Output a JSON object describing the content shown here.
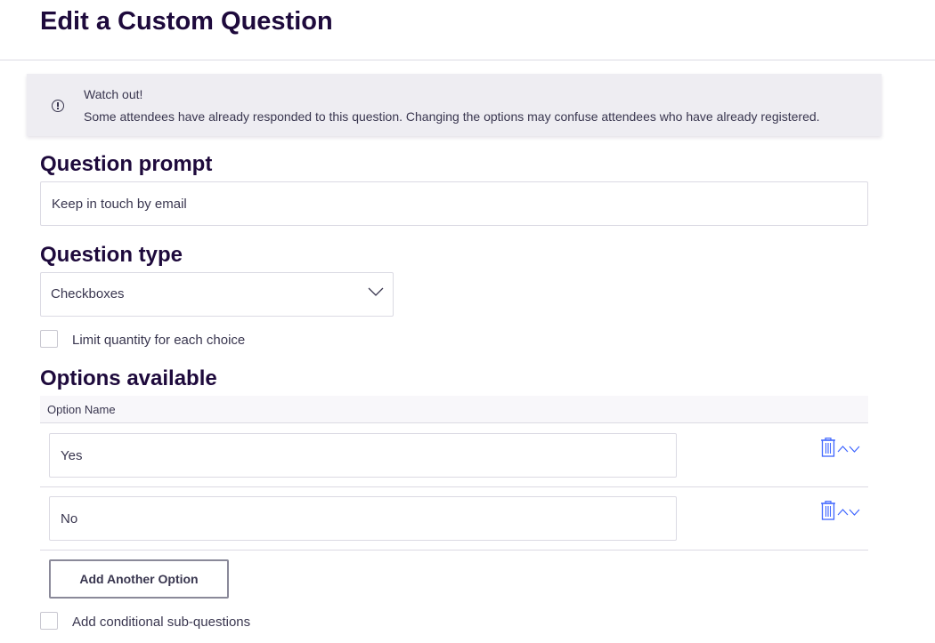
{
  "page": {
    "title": "Edit a Custom Question"
  },
  "alert": {
    "title": "Watch out!",
    "body": "Some attendees have already responded to this question. Changing the options may confuse attendees who have already registered.",
    "icon": "info-circle-icon"
  },
  "question_prompt": {
    "heading": "Question prompt",
    "value": "Keep in touch by email"
  },
  "question_type": {
    "heading": "Question type",
    "selected": "Checkboxes",
    "limit_quantity_label": "Limit quantity for each choice",
    "limit_quantity_checked": false
  },
  "options": {
    "heading": "Options available",
    "column_header": "Option Name",
    "items": [
      {
        "value": "Yes"
      },
      {
        "value": "No"
      }
    ],
    "add_button_label": "Add Another Option"
  },
  "conditional": {
    "label": "Add conditional sub-questions",
    "checked": false
  },
  "colors": {
    "heading": "#1e0a3c",
    "text": "#39364f",
    "border": "#dbdae3",
    "alert_bg": "#eeedf2",
    "icon_blue": "#3d64ff"
  }
}
